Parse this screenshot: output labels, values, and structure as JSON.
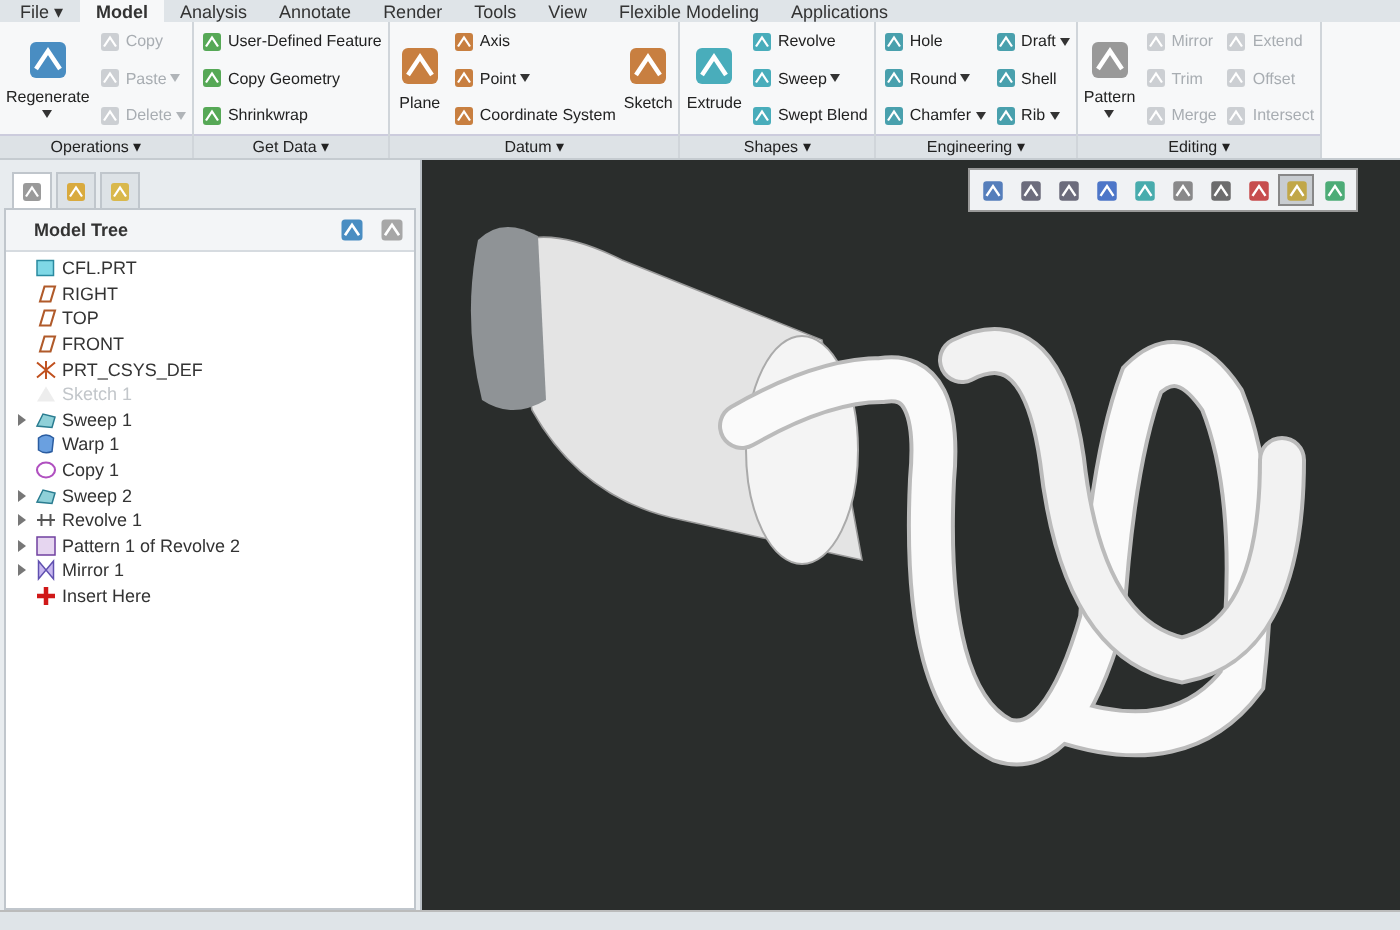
{
  "menu_tabs": [
    {
      "label": "File ▾",
      "selected": false
    },
    {
      "label": "Model",
      "selected": true
    },
    {
      "label": "Analysis",
      "selected": false
    },
    {
      "label": "Annotate",
      "selected": false
    },
    {
      "label": "Render",
      "selected": false
    },
    {
      "label": "Tools",
      "selected": false
    },
    {
      "label": "View",
      "selected": false
    },
    {
      "label": "Flexible Modeling",
      "selected": false
    },
    {
      "label": "Applications",
      "selected": false
    }
  ],
  "ribbon": {
    "groups": [
      {
        "label": "Operations ▾",
        "columns": [
          [
            {
              "kind": "large",
              "label": "Regenerate",
              "disabled": false,
              "dropdown": true
            }
          ],
          [
            {
              "kind": "small",
              "label": "Copy",
              "disabled": true,
              "dropdown": false
            },
            {
              "kind": "small",
              "label": "Paste",
              "disabled": true,
              "dropdown": true
            },
            {
              "kind": "small",
              "label": "Delete",
              "disabled": true,
              "dropdown": true
            }
          ]
        ]
      },
      {
        "label": "Get Data ▾",
        "columns": [
          [
            {
              "kind": "small",
              "label": "User-Defined Feature",
              "disabled": false,
              "dropdown": false
            },
            {
              "kind": "small",
              "label": "Copy Geometry",
              "disabled": false,
              "dropdown": false
            },
            {
              "kind": "small",
              "label": "Shrinkwrap",
              "disabled": false,
              "dropdown": false
            }
          ]
        ]
      },
      {
        "label": "Datum ▾",
        "columns": [
          [
            {
              "kind": "large",
              "label": "Plane",
              "disabled": false,
              "dropdown": false
            }
          ],
          [
            {
              "kind": "small",
              "label": "Axis",
              "disabled": false,
              "dropdown": false
            },
            {
              "kind": "small",
              "label": "Point",
              "disabled": false,
              "dropdown": true
            },
            {
              "kind": "small",
              "label": "Coordinate System",
              "disabled": false,
              "dropdown": false
            }
          ],
          [
            {
              "kind": "large",
              "label": "Sketch",
              "disabled": false,
              "dropdown": false
            }
          ]
        ]
      },
      {
        "label": "Shapes ▾",
        "columns": [
          [
            {
              "kind": "large",
              "label": "Extrude",
              "disabled": false,
              "dropdown": false
            }
          ],
          [
            {
              "kind": "small",
              "label": "Revolve",
              "disabled": false,
              "dropdown": false
            },
            {
              "kind": "small",
              "label": "Sweep",
              "disabled": false,
              "dropdown": true
            },
            {
              "kind": "small",
              "label": "Swept Blend",
              "disabled": false,
              "dropdown": false
            }
          ]
        ]
      },
      {
        "label": "Engineering ▾",
        "columns": [
          [
            {
              "kind": "small",
              "label": "Hole",
              "disabled": false,
              "dropdown": false
            },
            {
              "kind": "small",
              "label": "Round",
              "disabled": false,
              "dropdown": true
            },
            {
              "kind": "small",
              "label": "Chamfer",
              "disabled": false,
              "dropdown": true
            }
          ],
          [
            {
              "kind": "small",
              "label": "Draft",
              "disabled": false,
              "dropdown": true
            },
            {
              "kind": "small",
              "label": "Shell",
              "disabled": false,
              "dropdown": false
            },
            {
              "kind": "small",
              "label": "Rib",
              "disabled": false,
              "dropdown": true
            }
          ]
        ]
      },
      {
        "label": "Editing ▾",
        "columns": [
          [
            {
              "kind": "large",
              "label": "Pattern",
              "disabled": false,
              "dropdown": true
            }
          ],
          [
            {
              "kind": "small",
              "label": "Mirror",
              "disabled": true,
              "dropdown": false
            },
            {
              "kind": "small",
              "label": "Trim",
              "disabled": true,
              "dropdown": false
            },
            {
              "kind": "small",
              "label": "Merge",
              "disabled": true,
              "dropdown": false
            }
          ],
          [
            {
              "kind": "small",
              "label": "Extend",
              "disabled": true,
              "dropdown": false
            },
            {
              "kind": "small",
              "label": "Offset",
              "disabled": true,
              "dropdown": false
            },
            {
              "kind": "small",
              "label": "Intersect",
              "disabled": true,
              "dropdown": false
            }
          ]
        ]
      }
    ]
  },
  "panel_tabs": [
    {
      "selected": true
    },
    {
      "selected": false
    },
    {
      "selected": false
    }
  ],
  "model_tree": {
    "title": "Model Tree",
    "items": [
      {
        "label": "CFL.PRT",
        "kind": "part",
        "expandable": false,
        "disabled": false
      },
      {
        "label": "RIGHT",
        "kind": "plane",
        "expandable": false,
        "disabled": false
      },
      {
        "label": "TOP",
        "kind": "plane",
        "expandable": false,
        "disabled": false
      },
      {
        "label": "FRONT",
        "kind": "plane",
        "expandable": false,
        "disabled": false
      },
      {
        "label": "PRT_CSYS_DEF",
        "kind": "csys",
        "expandable": false,
        "disabled": false
      },
      {
        "label": "Sketch 1",
        "kind": "sketch",
        "expandable": false,
        "disabled": true
      },
      {
        "label": "Sweep 1",
        "kind": "sweep",
        "expandable": true,
        "disabled": false
      },
      {
        "label": "Warp 1",
        "kind": "warp",
        "expandable": false,
        "disabled": false
      },
      {
        "label": "Copy 1",
        "kind": "copy",
        "expandable": false,
        "disabled": false
      },
      {
        "label": "Sweep 2",
        "kind": "sweep",
        "expandable": true,
        "disabled": false
      },
      {
        "label": "Revolve 1",
        "kind": "revolve",
        "expandable": true,
        "disabled": false
      },
      {
        "label": "Pattern 1 of Revolve 2",
        "kind": "pattern",
        "expandable": true,
        "disabled": false
      },
      {
        "label": "Mirror 1",
        "kind": "mirror",
        "expandable": true,
        "disabled": false
      },
      {
        "label": "Insert Here",
        "kind": "insert",
        "expandable": false,
        "disabled": false
      }
    ]
  },
  "view_toolbar": [
    {
      "selected": false
    },
    {
      "selected": false
    },
    {
      "selected": false
    },
    {
      "selected": false
    },
    {
      "selected": false
    },
    {
      "selected": false
    },
    {
      "selected": false
    },
    {
      "selected": false
    },
    {
      "selected": true
    },
    {
      "selected": false
    }
  ]
}
